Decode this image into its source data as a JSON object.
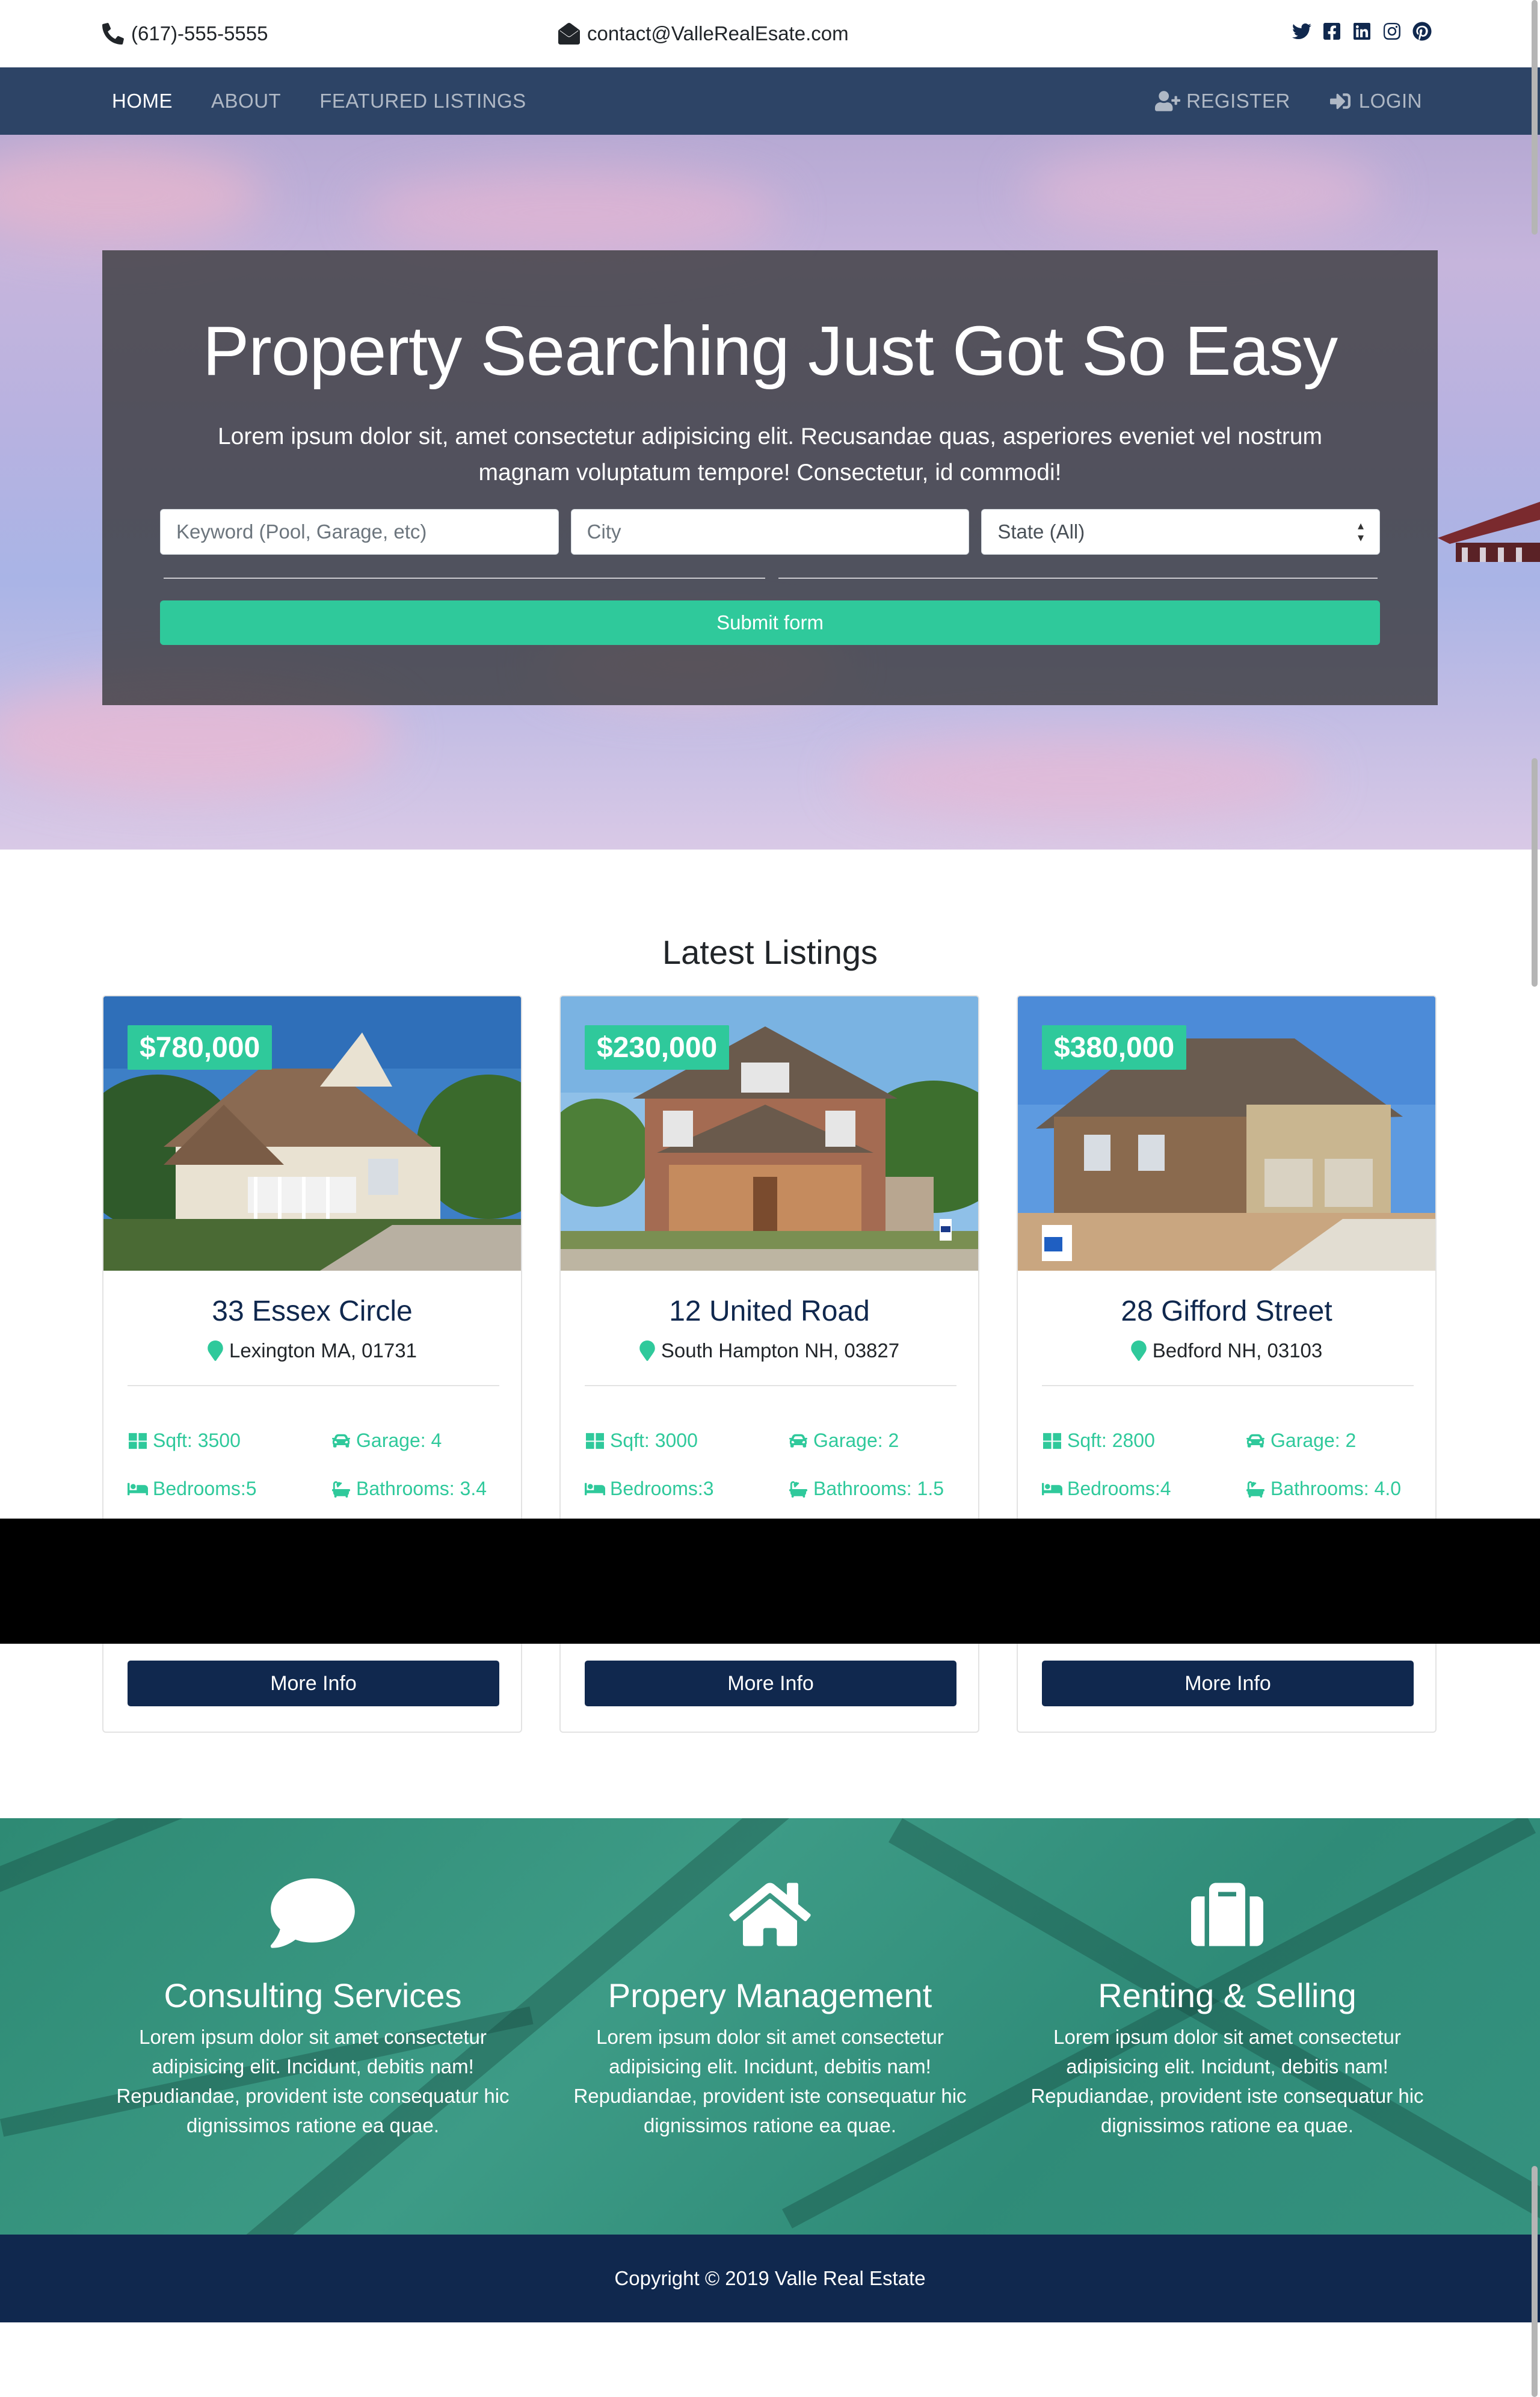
{
  "topbar": {
    "phone": "(617)-555-5555",
    "email": "contact@ValleRealEsate.com",
    "social_icons": [
      "twitter-icon",
      "facebook-icon",
      "linkedin-icon",
      "instagram-icon",
      "pinterest-icon"
    ]
  },
  "nav": {
    "items": [
      {
        "label": "HOME",
        "active": true
      },
      {
        "label": "ABOUT",
        "active": false
      },
      {
        "label": "FEATURED LISTINGS",
        "active": false
      }
    ],
    "register": "REGISTER",
    "login": "LOGIN"
  },
  "hero": {
    "title": "Property Searching Just Got So Easy",
    "subtitle": "Lorem ipsum dolor sit, amet consectetur adipisicing elit. Recusandae quas, asperiores eveniet vel nostrum magnam voluptatum tempore! Consectetur, id commodi!",
    "keyword_placeholder": "Keyword (Pool, Garage, etc)",
    "city_placeholder": "City",
    "state_value": "State (All)",
    "submit": "Submit form"
  },
  "listings": {
    "title": "Latest Listings",
    "cards": [
      {
        "price": "$780,000",
        "address": "33 Essex Circle",
        "location": "Lexington MA, 01731",
        "sqft": "Sqft: 3500",
        "garage": "Garage: 4",
        "bedrooms": "Bedrooms:5",
        "bathrooms": "Bathrooms: 3.4",
        "button": "More Info"
      },
      {
        "price": "$230,000",
        "address": "12 United Road",
        "location": "South Hampton NH, 03827",
        "sqft": "Sqft: 3000",
        "garage": "Garage: 2",
        "bedrooms": "Bedrooms:3",
        "bathrooms": "Bathrooms: 1.5",
        "button": "More Info"
      },
      {
        "price": "$380,000",
        "address": "28 Gifford Street",
        "location": "Bedford NH, 03103",
        "sqft": "Sqft: 2800",
        "garage": "Garage: 2",
        "bedrooms": "Bedrooms:4",
        "bathrooms": "Bathrooms: 4.0",
        "button": "More Info"
      }
    ]
  },
  "services": [
    {
      "icon": "speech-bubble-icon",
      "title": "Consulting Services",
      "text": "Lorem ipsum dolor sit amet consectetur adipisicing elit. Incidunt, debitis nam! Repudiandae, provident iste consequatur hic dignissimos ratione ea quae."
    },
    {
      "icon": "home-icon",
      "title": "Propery Management",
      "text": "Lorem ipsum dolor sit amet consectetur adipisicing elit. Incidunt, debitis nam! Repudiandae, provident iste consequatur hic dignissimos ratione ea quae."
    },
    {
      "icon": "suitcase-icon",
      "title": "Renting & Selling",
      "text": "Lorem ipsum dolor sit amet consectetur adipisicing elit. Incidunt, debitis nam! Repudiandae, provident iste consequatur hic dignissimos ratione ea quae."
    }
  ],
  "footer": {
    "copyright": "Copyright © 2019 Valle Real Estate"
  },
  "colors": {
    "navy": "#10284e",
    "nav_bg": "#2d4466",
    "accent": "#2fc99b",
    "services_bg": "#2e8a74"
  }
}
